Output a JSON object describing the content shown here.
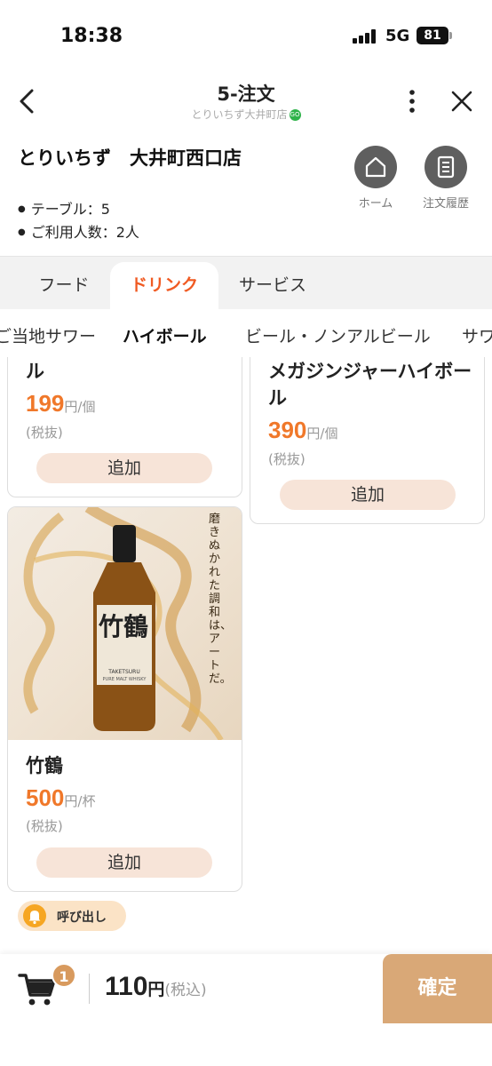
{
  "status_bar": {
    "time": "18:38",
    "network": "5G",
    "battery": "81"
  },
  "header": {
    "title": "5-注文",
    "subtitle": "とりいちず大井町店",
    "go_badge": "GO"
  },
  "store": {
    "name": "とりいちず　大井町西口店",
    "table": "テーブル：5",
    "guests": "ご利用人数：2人",
    "home_label": "ホーム",
    "history_label": "注文履歴"
  },
  "tabs": [
    {
      "label": "フード",
      "active": false
    },
    {
      "label": "ドリンク",
      "active": true
    },
    {
      "label": "サービス",
      "active": false
    }
  ],
  "subcategories": [
    {
      "label": "ご当地サワー",
      "active": false
    },
    {
      "label": "ハイボール",
      "active": true
    },
    {
      "label": "ビール・ノンアルビール",
      "active": false
    },
    {
      "label": "サワ",
      "active": false
    }
  ],
  "products": [
    {
      "name": "ル",
      "price": "199",
      "unit": "円/個",
      "tax": "(税抜)",
      "add_label": "追加"
    },
    {
      "name": "メガジンジャーハイボール",
      "price": "390",
      "unit": "円/個",
      "tax": "(税抜)",
      "add_label": "追加"
    },
    {
      "name": "竹鶴",
      "price": "500",
      "unit": "円/杯",
      "tax": "(税抜)",
      "add_label": "追加",
      "image": {
        "brand": "竹鶴",
        "label_en": "TAKETSURU",
        "label_sub": "PURE MALT WHISKY",
        "tagline": "磨きぬかれた調和は、アートだ。"
      }
    }
  ],
  "call_button": {
    "label": "呼び出し"
  },
  "cart": {
    "count": "1",
    "total": "110",
    "currency": "円",
    "tax_label": "(税込)",
    "confirm_label": "確定"
  },
  "colors": {
    "accent": "#f05a22",
    "price": "#f0782a",
    "confirm": "#d9a877",
    "add_button": "#f7e4d8"
  }
}
